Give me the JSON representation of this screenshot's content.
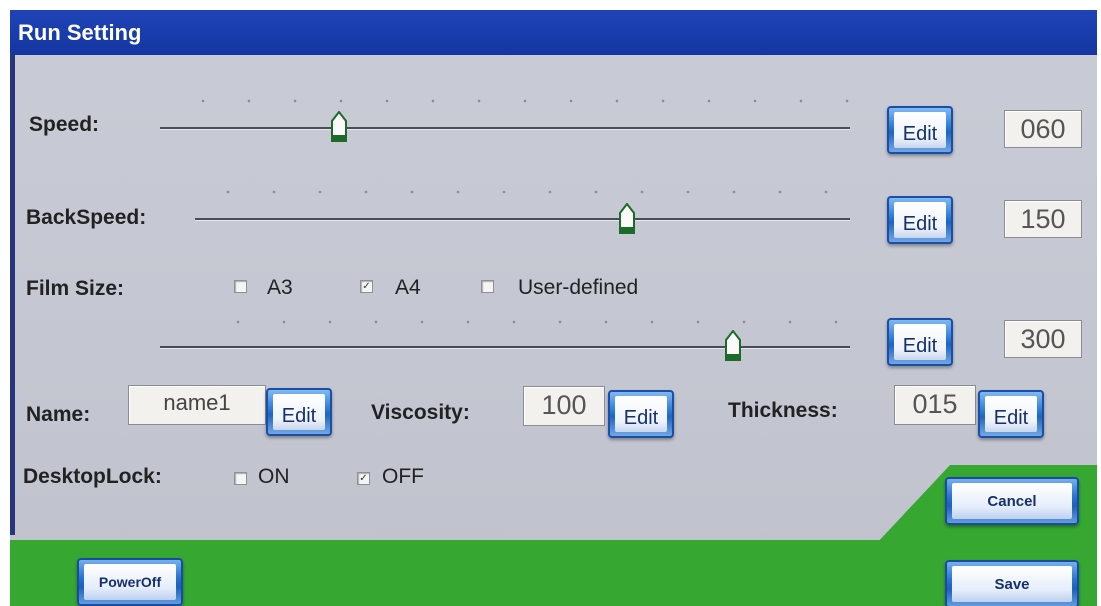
{
  "window": {
    "title": "Run Setting"
  },
  "speed": {
    "label": "Speed:",
    "value": "060",
    "edit_label": "Edit",
    "level": 0.26
  },
  "back_speed": {
    "label": "BackSpeed:",
    "value": "150",
    "edit_label": "Edit",
    "level": 0.66
  },
  "film_size": {
    "label": "Film Size:",
    "options": [
      {
        "label": "A3",
        "checked": false,
        "mark": ""
      },
      {
        "label": "A4",
        "checked": true,
        "mark": "✓"
      },
      {
        "label": "User-defined",
        "checked": false,
        "mark": ""
      }
    ],
    "value": "300",
    "edit_label": "Edit",
    "level": 0.83
  },
  "name": {
    "label": "Name:",
    "value": "name1",
    "edit_label": "Edit"
  },
  "viscosity": {
    "label": "Viscosity:",
    "value": "100",
    "edit_label": "Edit"
  },
  "thickness": {
    "label": "Thickness:",
    "value": "015",
    "edit_label": "Edit"
  },
  "desktop_lock": {
    "label": "DesktopLock:",
    "on": {
      "label": "ON",
      "checked": false,
      "mark": ""
    },
    "off": {
      "label": "OFF",
      "checked": true,
      "mark": "✓"
    }
  },
  "buttons": {
    "cancel": "Cancel",
    "save": "Save",
    "power_off": "PowerOff"
  },
  "colors": {
    "title_bar": "#1a3ca8",
    "panel": "#c6c8d3",
    "accent_green": "#36a832",
    "button_blue": "#2a74d2"
  }
}
